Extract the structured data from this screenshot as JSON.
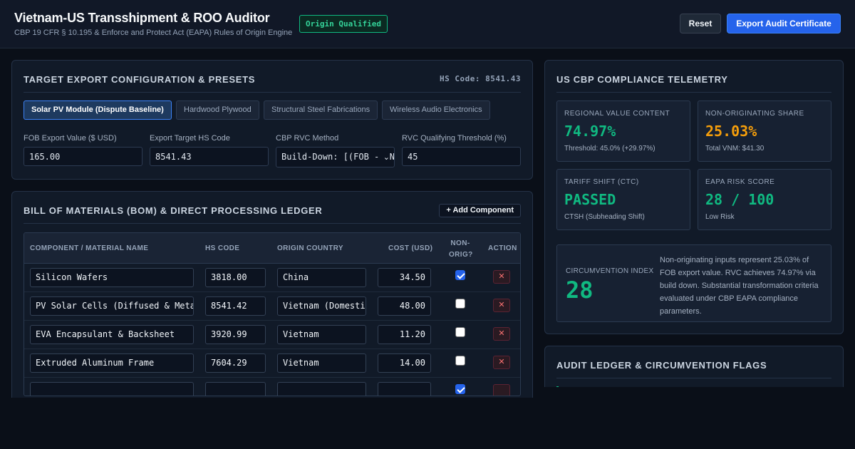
{
  "header": {
    "title": "Vietnam-US Transshipment & ROO Auditor",
    "subtitle": "CBP 19 CFR § 10.195 & Enforce and Protect Act (EAPA) Rules of Origin Engine",
    "status_badge": "Origin Qualified",
    "reset_label": "Reset",
    "export_label": "Export Audit Certificate"
  },
  "config": {
    "title": "Target Export Configuration & Presets",
    "hs_code_header": "HS Code: 8541.43",
    "presets": [
      {
        "label": "Solar PV Module (Dispute Baseline)",
        "active": true
      },
      {
        "label": "Hardwood Plywood",
        "active": false
      },
      {
        "label": "Structural Steel Fabrications",
        "active": false
      },
      {
        "label": "Wireless Audio Electronics",
        "active": false
      }
    ],
    "fields": {
      "fob_label": "FOB Export Value ($ USD)",
      "fob_value": "165.00",
      "hs_label": "Export Target HS Code",
      "hs_value": "8541.43",
      "rvc_method_label": "CBP RVC Method",
      "rvc_method_value": "Build-Down: [(FOB - VNM) / FOB]",
      "threshold_label": "RVC Qualifying Threshold (%)",
      "threshold_value": "45"
    }
  },
  "bom": {
    "title": "Bill of Materials (BOM) & Direct Processing Ledger",
    "add_label": "+ Add Component",
    "columns": {
      "name": "Component / Material Name",
      "hs": "HS Code",
      "origin": "Origin Country",
      "cost": "Cost (USD)",
      "non_orig_1": "Non-",
      "non_orig_2": "Orig?",
      "action": "Action"
    },
    "delete_symbol": "✕",
    "rows": [
      {
        "name": "Silicon Wafers",
        "hs": "3818.00",
        "origin": "China",
        "cost": "34.50",
        "non_orig": true
      },
      {
        "name": "PV Solar Cells (Diffused & Metallized)",
        "hs": "8541.42",
        "origin": "Vietnam (Domestic)",
        "cost": "48.00",
        "non_orig": false
      },
      {
        "name": "EVA Encapsulant & Backsheet",
        "hs": "3920.99",
        "origin": "Vietnam",
        "cost": "11.20",
        "non_orig": false
      },
      {
        "name": "Extruded Aluminum Frame",
        "hs": "7604.29",
        "origin": "Vietnam",
        "cost": "14.00",
        "non_orig": false
      }
    ]
  },
  "telemetry": {
    "title": "US CBP Compliance Telemetry",
    "metrics": [
      {
        "label": "Regional Value Content",
        "value": "74.97%",
        "sub": "Threshold: 45.0% (+29.97%)",
        "color": "#10b981"
      },
      {
        "label": "Non-Originating Share",
        "value": "25.03%",
        "sub": "Total VNM: $41.30",
        "color": "#f59e0b"
      },
      {
        "label": "Tariff Shift (CTC)",
        "value": "PASSED",
        "sub": "CTSH (Subheading Shift)",
        "color": "#10b981"
      },
      {
        "label": "EAPA Risk Score",
        "value": "28 / 100",
        "sub": "Low Risk",
        "color": "#10b981"
      }
    ],
    "circumvention": {
      "label": "Circumvention Index",
      "value": "28",
      "text": "Non-originating inputs represent 25.03% of FOB export value. RVC achieves 74.97% via build down. Substantial transformation criteria evaluated under CBP EAPA compliance parameters."
    }
  },
  "audit": {
    "title": "Audit Ledger & Circumvention Flags"
  }
}
